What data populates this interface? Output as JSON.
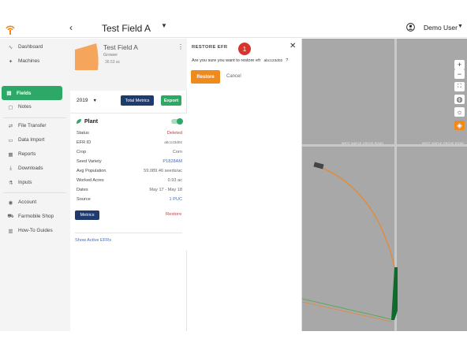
{
  "topbar": {
    "back_icon": "chevron-left-icon",
    "field_name": "Test Field A",
    "user_name": "Demo User"
  },
  "sidebar": {
    "items": [
      {
        "label": "Dashboard",
        "icon": "pulse-icon"
      },
      {
        "label": "Machines",
        "icon": "tractor-icon"
      },
      {
        "label": "Fields",
        "icon": "map-icon",
        "active": true
      },
      {
        "label": "Notes",
        "icon": "note-icon"
      },
      {
        "label": "File Transfer",
        "icon": "transfer-icon"
      },
      {
        "label": "Data Import",
        "icon": "import-icon"
      },
      {
        "label": "Reports",
        "icon": "reports-icon"
      },
      {
        "label": "Downloads",
        "icon": "download-icon"
      },
      {
        "label": "Inputs",
        "icon": "inputs-icon"
      },
      {
        "label": "Account",
        "icon": "account-icon"
      },
      {
        "label": "Farmobile Shop",
        "icon": "cart-icon"
      },
      {
        "label": "How-To Guides",
        "icon": "guide-icon"
      }
    ]
  },
  "field_card": {
    "title": "Test Field A",
    "grower": "Grower",
    "acres": "36.53 ac",
    "thumb_color": "#f5a55c"
  },
  "controls": {
    "year": "2019",
    "total_metrics_label": "Total Metrics",
    "export_label": "Export"
  },
  "efr": {
    "title": "Plant",
    "toggle_on": true,
    "rows": [
      {
        "key": "Status",
        "value": "Deleted"
      },
      {
        "key": "EFR ID",
        "value": "abc123d02"
      },
      {
        "key": "Crop",
        "value": "Corn"
      },
      {
        "key": "Seed Variety",
        "value": "P1828AM"
      },
      {
        "key": "Avg Population",
        "value": "59,089.46 seeds/ac"
      },
      {
        "key": "Worked Acres",
        "value": "0.93 ac"
      },
      {
        "key": "Dates",
        "value": "May 17 - May 18"
      },
      {
        "key": "Source",
        "value": "1 PUC"
      }
    ],
    "metrics_label": "Metrics",
    "restore_label": "Restore",
    "show_active_label": "Show Active EFRs"
  },
  "dialog": {
    "title": "RESTORE EFR",
    "step": "1",
    "message": "Are you sure you want to restore efr",
    "efr_id": "abc123d02",
    "question_mark": "?",
    "confirm_label": "Restore",
    "cancel_label": "Cancel"
  },
  "map": {
    "road_label": "WEST MAPLE GROVE ROAD",
    "controls": [
      {
        "label": "+",
        "icon": "zoom-in-icon"
      },
      {
        "label": "−",
        "icon": "zoom-out-icon"
      },
      {
        "label": "⛶",
        "icon": "fullscreen-icon"
      },
      {
        "label": "◍",
        "icon": "globe-icon"
      },
      {
        "label": "☼",
        "icon": "brightness-icon"
      },
      {
        "label": "◈",
        "icon": "layers-icon"
      }
    ],
    "colors": {
      "path": "#e8882e",
      "planted": "#0f6b2c",
      "background": "#a8a8a8",
      "road": "#c9c9c9"
    }
  },
  "colors": {
    "accent": "#2ea866",
    "navy": "#1f3a6e",
    "orange": "#ef8a1d",
    "danger": "#c73e3e",
    "link": "#3b6fc7"
  }
}
